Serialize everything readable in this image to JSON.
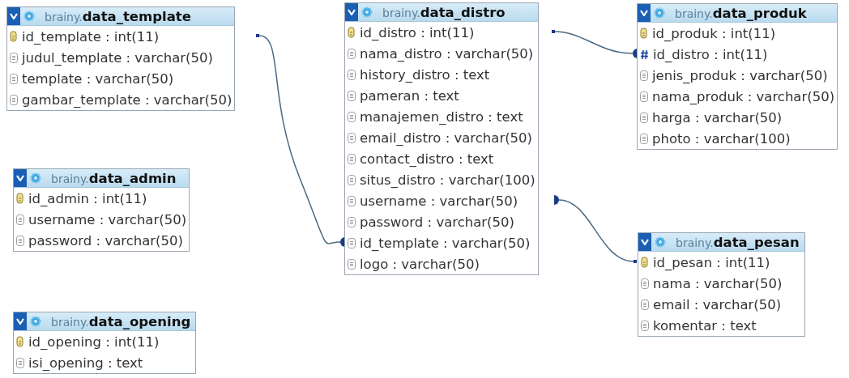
{
  "tables": [
    {
      "schema": "brainy.",
      "name": "data_template",
      "columns": [
        {
          "kind": "primary",
          "label": "id_template : int(11)"
        },
        {
          "kind": "column",
          "label": "judul_template : varchar(50)"
        },
        {
          "kind": "column",
          "label": "template : varchar(50)"
        },
        {
          "kind": "column",
          "label": "gambar_template : varchar(50)"
        }
      ]
    },
    {
      "schema": "brainy.",
      "name": "data_distro",
      "columns": [
        {
          "kind": "primary",
          "label": "id_distro : int(11)"
        },
        {
          "kind": "column",
          "label": "nama_distro : varchar(50)"
        },
        {
          "kind": "column",
          "label": "history_distro : text"
        },
        {
          "kind": "column",
          "label": "pameran : text"
        },
        {
          "kind": "column",
          "label": "manajemen_distro : text"
        },
        {
          "kind": "column",
          "label": "email_distro : varchar(50)"
        },
        {
          "kind": "column",
          "label": "contact_distro : text"
        },
        {
          "kind": "column",
          "label": "situs_distro : varchar(100)"
        },
        {
          "kind": "column",
          "label": "username : varchar(50)"
        },
        {
          "kind": "column",
          "label": "password : varchar(50)"
        },
        {
          "kind": "column",
          "label": "id_template : varchar(50)"
        },
        {
          "kind": "column",
          "label": "logo : varchar(50)"
        }
      ]
    },
    {
      "schema": "brainy.",
      "name": "data_produk",
      "columns": [
        {
          "kind": "primary",
          "label": "id_produk : int(11)"
        },
        {
          "kind": "foreign",
          "label": "id_distro : int(11)"
        },
        {
          "kind": "column",
          "label": "jenis_produk : varchar(50)"
        },
        {
          "kind": "column",
          "label": "nama_produk : varchar(50)"
        },
        {
          "kind": "column",
          "label": "harga : varchar(50)"
        },
        {
          "kind": "column",
          "label": "photo : varchar(100)"
        }
      ]
    },
    {
      "schema": "brainy.",
      "name": "data_admin",
      "columns": [
        {
          "kind": "primary",
          "label": "id_admin : int(11)"
        },
        {
          "kind": "column",
          "label": "username : varchar(50)"
        },
        {
          "kind": "column",
          "label": "password : varchar(50)"
        }
      ]
    },
    {
      "schema": "brainy.",
      "name": "data_pesan",
      "columns": [
        {
          "kind": "primary",
          "label": "id_pesan : int(11)"
        },
        {
          "kind": "column",
          "label": "nama : varchar(50)"
        },
        {
          "kind": "column",
          "label": "email : varchar(50)"
        },
        {
          "kind": "column",
          "label": "komentar : text"
        }
      ]
    },
    {
      "schema": "brainy.",
      "name": "data_opening",
      "columns": [
        {
          "kind": "primary",
          "label": "id_opening : int(11)"
        },
        {
          "kind": "column",
          "label": "isi_opening : text"
        }
      ]
    }
  ]
}
